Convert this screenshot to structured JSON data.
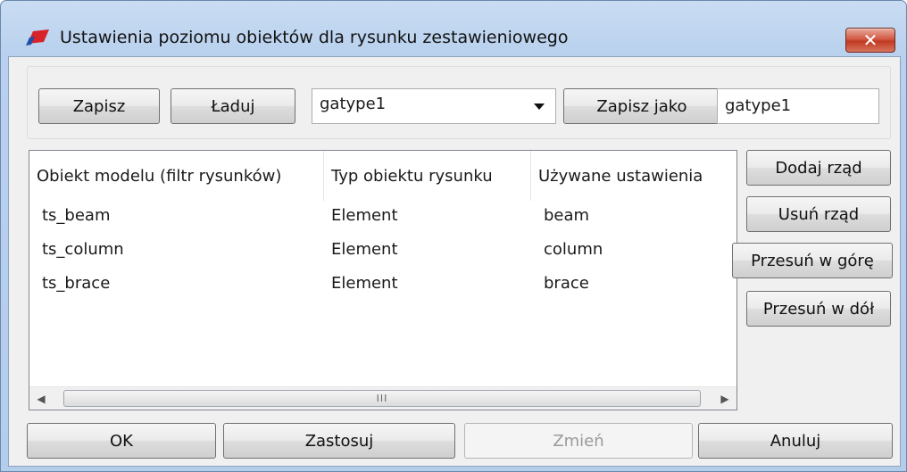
{
  "window": {
    "title": "Ustawienia poziomu obiektów dla rysunku zestawieniowego",
    "close_glyph": "✕"
  },
  "toolbar": {
    "save_label": "Zapisz",
    "load_label": "Ładuj",
    "settings_select_value": "gatype1",
    "save_as_label": "Zapisz jako",
    "save_as_name": "gatype1"
  },
  "table": {
    "headers": [
      "Obiekt modelu (filtr rysunków)",
      "Typ obiektu rysunku",
      "Używane ustawienia"
    ],
    "rows": [
      [
        "ts_beam",
        "Element",
        "beam"
      ],
      [
        "ts_column",
        "Element",
        "column"
      ],
      [
        "ts_brace",
        "Element",
        "brace"
      ]
    ],
    "scroll_thumb_grip": "III"
  },
  "side_buttons": {
    "add_row": "Dodaj rząd",
    "remove_row": "Usuń rząd",
    "move_up": "Przesuń w górę",
    "move_down": "Przesuń w dół"
  },
  "footer": {
    "ok": "OK",
    "apply": "Zastosuj",
    "modify": "Zmień",
    "cancel": "Anuluj"
  },
  "colors": {
    "title_gradient_top": "#c9dcf2",
    "close_button": "#c13a22",
    "client_bg": "#f0f0f0",
    "app_icon_red": "#d8232a",
    "app_icon_blue": "#1f4fa8"
  }
}
